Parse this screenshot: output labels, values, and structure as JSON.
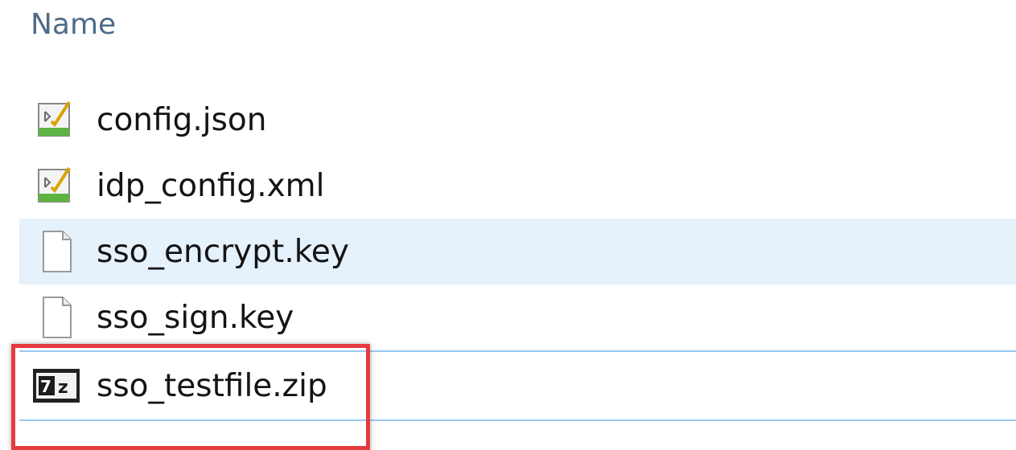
{
  "header": {
    "name_column": "Name"
  },
  "files": [
    {
      "name": "config.json",
      "icon": "json-file-icon"
    },
    {
      "name": "idp_config.xml",
      "icon": "xml-file-icon"
    },
    {
      "name": "sso_encrypt.key",
      "icon": "blank-file-icon"
    },
    {
      "name": "sso_sign.key",
      "icon": "blank-file-icon"
    },
    {
      "name": "sso_testfile.zip",
      "icon": "7z-archive-icon"
    }
  ],
  "colors": {
    "header_text": "#4d6b8a",
    "selection_bg": "#e5f1fb",
    "focus_border": "#99c9ef",
    "highlight_border": "#e53b3f"
  }
}
